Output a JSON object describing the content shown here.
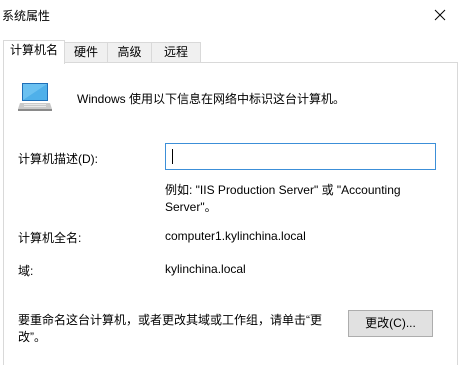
{
  "window": {
    "title": "系统属性",
    "close_icon": "close-icon"
  },
  "tabs": [
    {
      "label": "计算机名",
      "active": true
    },
    {
      "label": "硬件",
      "active": false
    },
    {
      "label": "高级",
      "active": false
    },
    {
      "label": "远程",
      "active": false
    }
  ],
  "panel": {
    "icon": "computer-icon",
    "intro": "Windows 使用以下信息在网络中标识这台计算机。",
    "description_label": "计算机描述(D):",
    "description_value": "",
    "example_text": "例如: \"IIS Production Server\" 或 \"Accounting Server\"。",
    "full_name_label": "计算机全名:",
    "full_name_value": "computer1.kylinchina.local",
    "domain_label": "域:",
    "domain_value": "kylinchina.local",
    "rename_text": "要重命名这台计算机，或者更改其域或工作组，请单击“更改”。",
    "change_button": "更改(C)..."
  },
  "colors": {
    "input_focus_border": "#3c8fd8",
    "tab_border": "#d9d9d9",
    "button_bg": "#e1e1e1"
  }
}
